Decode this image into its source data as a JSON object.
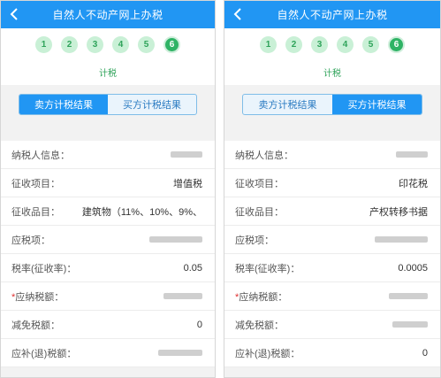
{
  "header_title": "自然人不动产网上办税",
  "steps": [
    "1",
    "2",
    "3",
    "4",
    "5",
    "6"
  ],
  "steps_label": "计税",
  "tabs": {
    "seller": "卖方计税结果",
    "buyer": "买方计税结果"
  },
  "left_panel": {
    "active_tab": "seller",
    "rows": [
      {
        "label": "纳税人信息：",
        "value": "",
        "obscured": true,
        "required": false
      },
      {
        "label": "征收项目：",
        "value": "增值税",
        "obscured": false,
        "required": false
      },
      {
        "label": "征收品目：",
        "value": "建筑物（11%、10%、9%、",
        "obscured": false,
        "required": false
      },
      {
        "label": "应税项：",
        "value": "",
        "obscured": true,
        "required": false
      },
      {
        "label": "税率(征收率)：",
        "value": "0.05",
        "obscured": false,
        "required": false
      },
      {
        "label": "应纳税额：",
        "value": "",
        "obscured": true,
        "required": true
      },
      {
        "label": "减免税额：",
        "value": "0",
        "obscured": false,
        "required": false
      },
      {
        "label": "应补(退)税额：",
        "value": "",
        "obscured": true,
        "required": false
      }
    ]
  },
  "right_panel": {
    "active_tab": "buyer",
    "rows": [
      {
        "label": "纳税人信息：",
        "value": "",
        "obscured": true,
        "required": false
      },
      {
        "label": "征收项目：",
        "value": "印花税",
        "obscured": false,
        "required": false
      },
      {
        "label": "征收品目：",
        "value": "产权转移书据",
        "obscured": false,
        "required": false
      },
      {
        "label": "应税项：",
        "value": "",
        "obscured": true,
        "required": false
      },
      {
        "label": "税率(征收率)：",
        "value": "0.0005",
        "obscured": false,
        "required": false
      },
      {
        "label": "应纳税额：",
        "value": "",
        "obscured": true,
        "required": true
      },
      {
        "label": "减免税额：",
        "value": "",
        "obscured": true,
        "required": false
      },
      {
        "label": "应补(退)税额：",
        "value": "0",
        "obscured": false,
        "required": false
      }
    ]
  },
  "colors": {
    "header": "#2196f3",
    "step": "#2fb365",
    "required_mark": "#e03030"
  },
  "icons": {
    "back": "chevron-left-icon"
  }
}
